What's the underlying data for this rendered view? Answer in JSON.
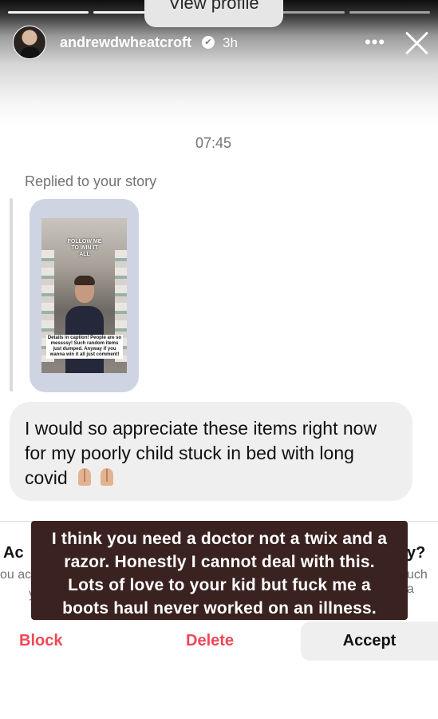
{
  "header": {
    "view_profile_label": "View profile",
    "username": "andrewdwheatcroft",
    "verified_symbol": "✔",
    "time_ago": "3h",
    "more_symbol": "•••",
    "progress_segments": 5,
    "progress_done": 3
  },
  "conversation": {
    "timestamp": "07:45",
    "replied_label": "Replied to your story",
    "story_preview": {
      "headline": "FOLLOW ME TO WIN IT ALL",
      "caption": "Details in caption! People are so messssy! Such random items just dumped. Anyway if you wanna win it all just comment!"
    },
    "message": "I would so appreciate these items right now for my poorly child stuck in bed with long covid"
  },
  "request": {
    "title_left": "Ac",
    "title_right": "y?",
    "sub_left": "ou ac",
    "sub_right": "uch a",
    "sub_line2": "y",
    "block_label": "Block",
    "delete_label": "Delete",
    "accept_label": "Accept"
  },
  "overlay": {
    "lines": [
      "I think you need a doctor not a twix and a",
      "razor. Honestly I cannot deal with this.",
      "Lots of love to your kid but fuck me a",
      "boots haul never worked on an illness."
    ]
  },
  "colors": {
    "danger": "#ed4956",
    "overlay_bg": "#3a2220",
    "bubble_bg": "#efeff0"
  }
}
